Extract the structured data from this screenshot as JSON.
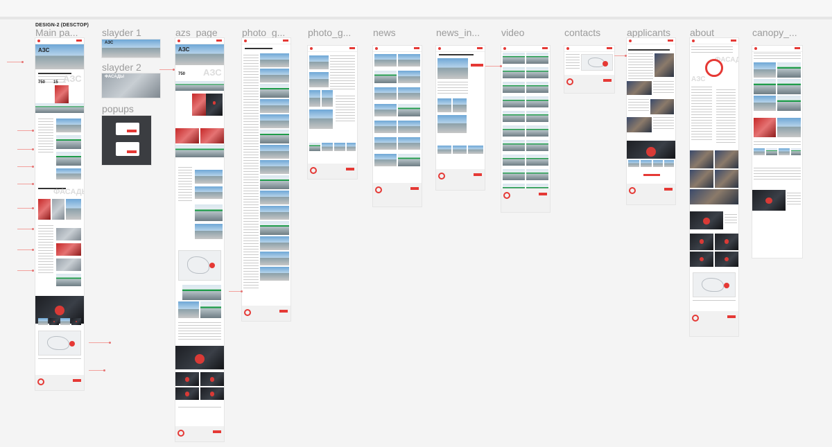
{
  "canvas": {
    "section_label": "DESIGN-2 (DESCTOP)"
  },
  "frames": [
    {
      "id": "main",
      "title": "Main pa..."
    },
    {
      "id": "slayder1",
      "title": "slayder 1"
    },
    {
      "id": "slayder2",
      "title": "slayder 2"
    },
    {
      "id": "popups",
      "title": "popups"
    },
    {
      "id": "azs",
      "title": "azs_page"
    },
    {
      "id": "photo1",
      "title": "photo_g..."
    },
    {
      "id": "photo2",
      "title": "photo_g..."
    },
    {
      "id": "news",
      "title": "news"
    },
    {
      "id": "news_in",
      "title": "news_in..."
    },
    {
      "id": "video",
      "title": "video"
    },
    {
      "id": "contacts",
      "title": "contacts"
    },
    {
      "id": "applicants",
      "title": "applicants"
    },
    {
      "id": "about",
      "title": "about"
    },
    {
      "id": "canopy",
      "title": "canopy_..."
    }
  ],
  "content": {
    "azs_big": "АЗС",
    "facades_big": "ФАСАДЫ",
    "slider1_caption": "АЗС",
    "slider2_caption": "ФАСАДЫ",
    "main_price_1": "750",
    "main_price_2": "15",
    "azs_price": "750",
    "about_azs": "АЗС",
    "about_facades": "ФАСАДЫ"
  },
  "colors": {
    "accent": "#e53935",
    "canvas_bg": "#f4f4f4",
    "frame_title": "#9b9b9b"
  }
}
